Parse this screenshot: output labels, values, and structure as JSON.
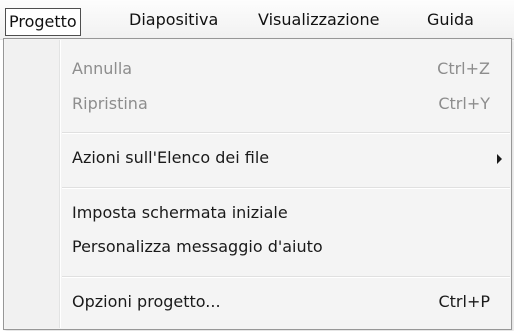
{
  "menubar": {
    "items": [
      {
        "label": "Progetto",
        "active": true
      },
      {
        "label": "Diapositiva"
      },
      {
        "label": "Visualizzazione"
      },
      {
        "label": "Guida"
      }
    ]
  },
  "dropdown": {
    "items": [
      {
        "label": "Annulla",
        "shortcut": "Ctrl+Z",
        "disabled": true
      },
      {
        "label": "Ripristina",
        "shortcut": "Ctrl+Y",
        "disabled": true
      },
      {
        "label": "Azioni sull'Elenco dei file",
        "submenu": true,
        "submenu_icon": "chevron-right-icon"
      },
      {
        "label": "Imposta schermata iniziale"
      },
      {
        "label": "Personalizza messaggio d'aiuto"
      },
      {
        "label": "Opzioni progetto...",
        "shortcut": "Ctrl+P"
      }
    ]
  },
  "colors": {
    "menu_background": "#f4f4f4",
    "disabled_text": "#8d8d8d",
    "text": "#1a1a1a",
    "border": "#979797"
  }
}
